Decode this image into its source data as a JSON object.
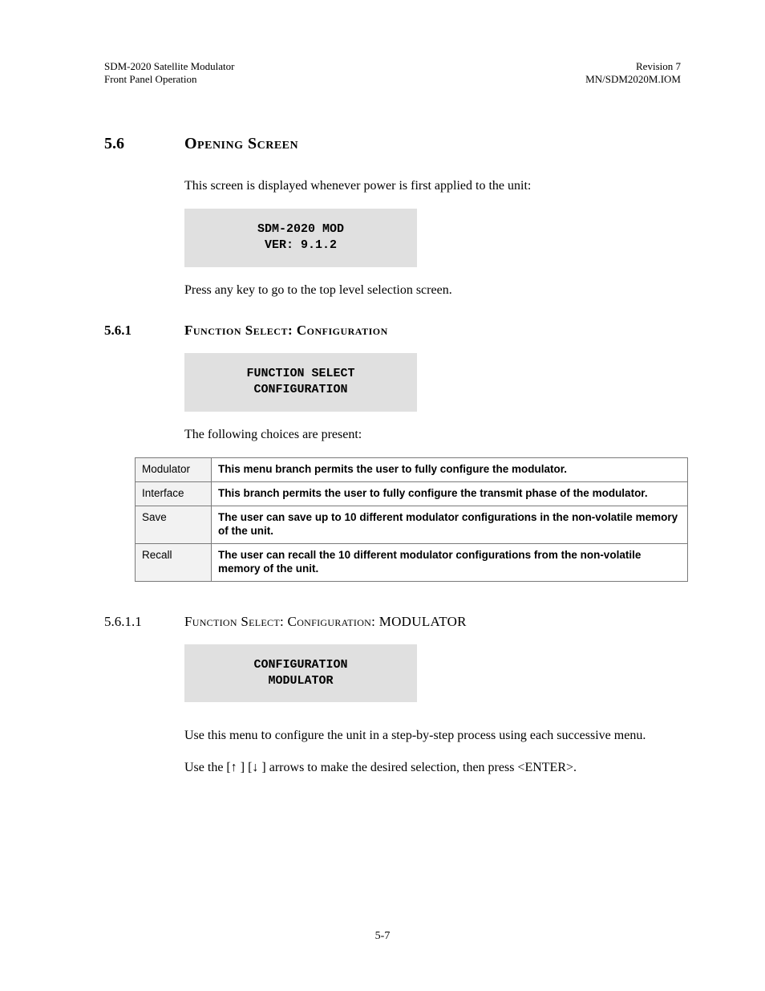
{
  "header": {
    "left": "SDM-2020特Satellite特Modulator\nFront特Panel特Operation",
    "right": "Revision特7\nMN/SDM2020M.IOM"
  },
  "section56": {
    "num": "5.6",
    "title": "Opening Screen",
    "intro": "This screen is displayed whenever power is first applied to the unit:",
    "lcd": "SDM-2020 MOD\nVER: 9.1.2",
    "after": "Press any key to go to the top level selection screen."
  },
  "section561": {
    "num": "5.6.1",
    "title": "Function Select: Configuration",
    "lcd": "FUNCTION SELECT\nCONFIGURATION",
    "choices_intro": "The following choices are present:",
    "rows": [
      {
        "label": "Modulator",
        "desc": "This menu branch permits the user to fully configure the modulator."
      },
      {
        "label": "Interface",
        "desc": "This branch permits the user to fully configure the transmit phase  of the modulator."
      },
      {
        "label": "Save",
        "desc": "The user can save up to 10 different modulator configurations in the non-volatile memory of the unit."
      },
      {
        "label": "Recall",
        "desc": "The user can recall the 10 different modulator configurations from the non-volatile memory of the unit."
      }
    ]
  },
  "section5611": {
    "num": "5.6.1.1",
    "title": "Function Select: Configuration: MODULATOR",
    "lcd": "CONFIGURATION\nMODULATOR",
    "p1_a": "Use this menu ",
    "p1_b": "to",
    "p1_c": " configure the unit in a step-by-step process using each successive menu.",
    "p2_a": "Use the [",
    "p2_b": "↑",
    "p2_c": " ] [",
    "p2_d": "↓",
    "p2_e": " ]  arrows to make the desired selection, then press <ENTER>."
  },
  "footer": "5-7"
}
